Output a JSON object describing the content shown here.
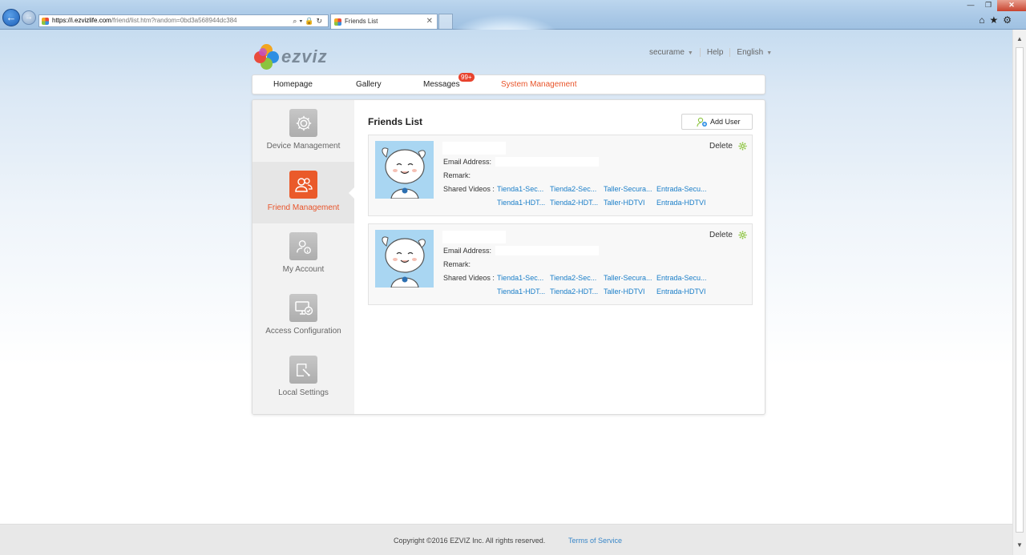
{
  "browser": {
    "url_host": "https://i.ezvizlife.com",
    "url_path": "/friend/list.htm?random=0bd3a568944dc384",
    "tab_title": "Friends List"
  },
  "header": {
    "brand": "ezviz",
    "user": "securame",
    "help": "Help",
    "language": "English"
  },
  "nav": {
    "items": [
      {
        "label": "Homepage"
      },
      {
        "label": "Gallery"
      },
      {
        "label": "Messages",
        "badge": "99+"
      },
      {
        "label": "System Management",
        "active": true
      }
    ]
  },
  "sidebar": {
    "items": [
      {
        "label": "Device Management",
        "icon": "gear-icon"
      },
      {
        "label": "Friend Management",
        "icon": "friends-icon",
        "active": true
      },
      {
        "label": "My Account",
        "icon": "account-icon"
      },
      {
        "label": "Access Configuration",
        "icon": "monitor-check-icon"
      },
      {
        "label": "Local Settings",
        "icon": "folder-edit-icon"
      }
    ]
  },
  "main": {
    "title": "Friends List",
    "add_user_label": "Add User",
    "email_label": "Email Address:",
    "remark_label": "Remark:",
    "shared_label": "Shared Videos :",
    "delete_label": "Delete",
    "friends": [
      {
        "shared_videos": [
          "Tienda1-Sec...",
          "Tienda2-Sec...",
          "Taller-Secura...",
          "Entrada-Secu...",
          "Tienda1-HDT...",
          "Tienda2-HDT...",
          "Taller-HDTVI",
          "Entrada-HDTVI"
        ]
      },
      {
        "shared_videos": [
          "Tienda1-Sec...",
          "Tienda2-Sec...",
          "Taller-Secura...",
          "Entrada-Secu...",
          "Tienda1-HDT...",
          "Tienda2-HDT...",
          "Taller-HDTVI",
          "Entrada-HDTVI"
        ]
      }
    ]
  },
  "footer": {
    "copyright": "Copyright ©2016 EZVIZ Inc. All rights reserved.",
    "terms": "Terms of Service"
  },
  "colors": {
    "accent": "#e8542a",
    "link": "#1a7ec8",
    "gear_green": "#8cc43f"
  }
}
